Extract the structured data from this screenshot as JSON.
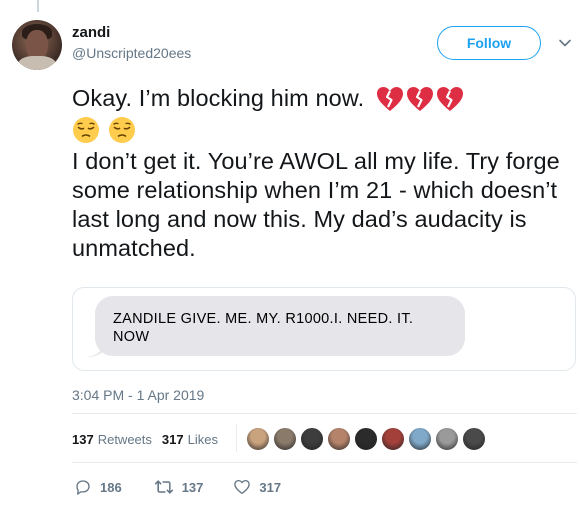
{
  "user": {
    "name": "zandi",
    "handle": "@Unscripted20ees"
  },
  "follow_label": "Follow",
  "tweet": {
    "line1": "Okay. I’m blocking him now.",
    "paragraph2": "I don’t get it. You’re AWOL all my life. Try forge some relationship when I’m 21 - which doesn’t last long and now this. My dad’s audacity is unmatched."
  },
  "emojis": [
    "broken-heart-icon",
    "broken-heart-icon",
    "broken-heart-icon",
    "pensive-face-icon",
    "pensive-face-icon"
  ],
  "image_card": {
    "message": "ZANDILE  GIVE. ME. MY. R1000.I. NEED. IT. NOW"
  },
  "timestamp": "3:04 PM - 1 Apr 2019",
  "stats": {
    "retweets_count": "137",
    "retweets_label": "Retweets",
    "likes_count": "317",
    "likes_label": "Likes"
  },
  "likers": [
    "#c9a27e",
    "#8a7a6a",
    "#3d3d3d",
    "#b5836a",
    "#2b2b2b",
    "#a3403a",
    "#7fa8c9",
    "#9a9a9a",
    "#4a4a4a"
  ],
  "actions": {
    "replies": "186",
    "retweets": "137",
    "likes": "317"
  },
  "colors": {
    "accent": "#1da1f2",
    "muted": "#657786",
    "border": "#e6ecf0",
    "bubble": "#e5e5ea",
    "heart": "#e0245e",
    "emoji_face": "#ffcc4d"
  }
}
